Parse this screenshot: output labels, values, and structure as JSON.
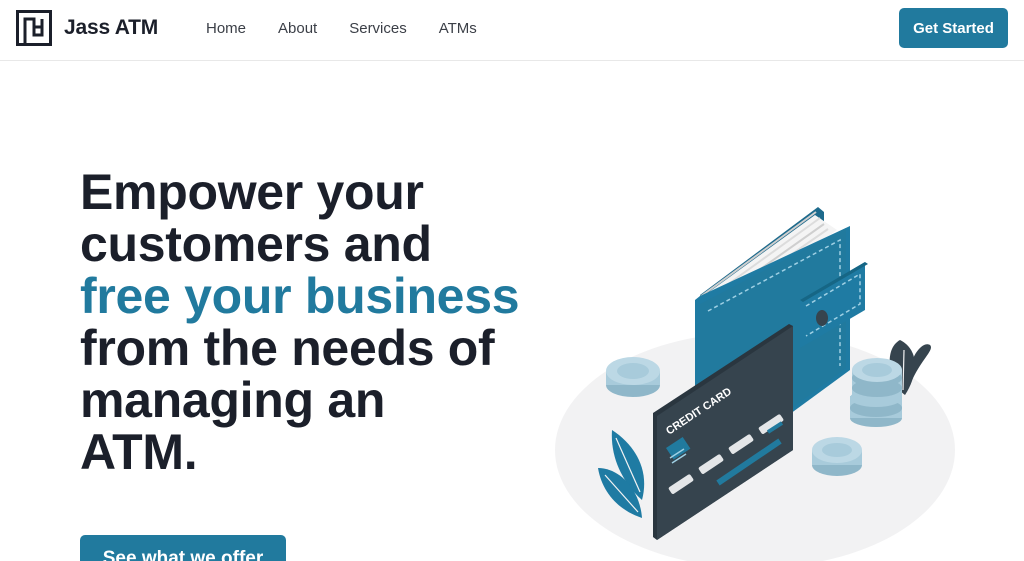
{
  "header": {
    "brand": "Jass ATM",
    "logo_icon": "maze-square-icon",
    "nav": [
      {
        "label": "Home"
      },
      {
        "label": "About"
      },
      {
        "label": "Services"
      },
      {
        "label": "ATMs"
      }
    ],
    "cta_label": "Get Started"
  },
  "hero": {
    "line1": "Empower your",
    "line2": "customers and",
    "line3_accent": "free your business",
    "line4": "from the needs of",
    "line5": "managing an",
    "line6": "ATM.",
    "button_label": "See what we offer",
    "illustration": {
      "icon": "wallet-credit-card-illustration",
      "card_text": "CREDIT CARD"
    }
  },
  "colors": {
    "accent": "#217a9e",
    "text": "#1b1f2a",
    "card_dark": "#36444e",
    "coin": "#a8cbdb"
  }
}
